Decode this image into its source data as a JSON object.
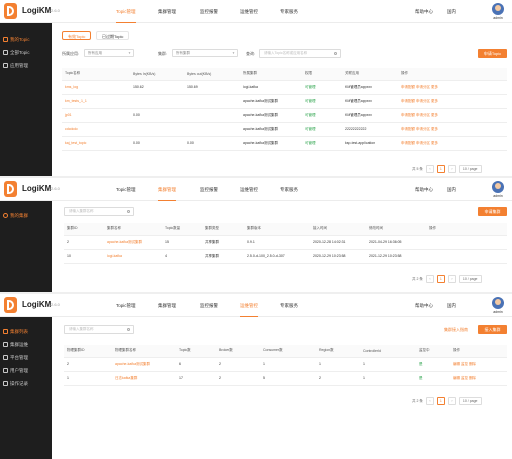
{
  "app": {
    "brand": "LogiKM",
    "version": "v2.6.0",
    "help": "帮助中心",
    "lang": "国内",
    "user": "admin"
  },
  "nav": [
    "Topic管理",
    "集群管理",
    "监控报警",
    "运维管控",
    "专家服务"
  ],
  "panel1": {
    "sidebar": [
      "我的Topic",
      "全部Topic",
      "应用管理"
    ],
    "tabs": [
      "有效Topic",
      "已过期Topic"
    ],
    "filter": {
      "app_label": "所属应用:",
      "app_value": "所有应用",
      "cluster_label": "集群:",
      "cluster_value": "所有集群",
      "search_label": "查询:",
      "search_placeholder": "请输入Topic名称或应用名称"
    },
    "apply_button": "申请Topic",
    "columns": [
      "Topic名称",
      "Bytes In(KB/s)",
      "Bytes out(KB/s)",
      "所属集群",
      "权限",
      "关联应用",
      "操作"
    ],
    "rows": [
      [
        "kms_log",
        "150.62",
        "150.69",
        "logi-kafka",
        "可管理",
        "KM管理员appxxx",
        "申请配额 申请分区 更多"
      ],
      [
        "km_tests_1_1",
        "",
        "",
        "apache-kafka测试集群",
        "可管理",
        "KM管理员appxxx",
        "申请配额 申请分区 更多"
      ],
      [
        "jp01",
        "0.00",
        "",
        "apache-kafka测试集群",
        "可管理",
        "KM管理员appxxx",
        "申请配额 申请分区 更多"
      ],
      [
        "cdcdcdc",
        "",
        "",
        "apache-kafka测试集群",
        "可管理",
        "22222222222",
        "申请配额 申请分区 更多"
      ],
      [
        "kaj_test_topic",
        "0.00",
        "0.00",
        "apache-kafka测试集群",
        "可管理",
        "ksp-test-application",
        "申请配额 申请分区 更多"
      ]
    ],
    "pagination": {
      "total": "共 5 条",
      "page": "1",
      "size": "10 / page"
    }
  },
  "panel2": {
    "sidebar": [
      "我的集群"
    ],
    "search_placeholder": "请输入集群名称",
    "apply_button": "申请集群",
    "columns": [
      "集群ID",
      "集群名称",
      "Topic数量",
      "集群类型",
      "集群版本",
      "接入时间",
      "修改时间",
      "操作"
    ],
    "rows": [
      [
        "2",
        "apache-kafka测试集群",
        "15",
        "共享集群",
        "0.9.1",
        "2020-12-28 14:02:31",
        "2021-04-29 16:36:05",
        ""
      ],
      [
        "10",
        "logi-kafka",
        "4",
        "共享集群",
        "2.5.0-d-100_2.5.0-d-307",
        "2020-12-29 10:23:58",
        "2021-12-29 10:23:58",
        ""
      ]
    ],
    "pagination": {
      "total": "共 2 条",
      "page": "1",
      "size": "10 / page"
    }
  },
  "panel3": {
    "sidebar": [
      "集群列表",
      "集群运维",
      "平台管理",
      "用户管理",
      "操作记录"
    ],
    "search_placeholder": "请输入集群名称",
    "extra_link": "集群接入指南",
    "add_button": "接入集群",
    "columns": [
      "物理集群ID",
      "物理集群名称",
      "Topic数",
      "Broker数",
      "Consumer数",
      "Region数",
      "Controllerld",
      "监控中",
      "操作"
    ],
    "rows": [
      [
        "2",
        "apache-kafka测试集群",
        "6",
        "2",
        "1",
        "1",
        "1",
        "是",
        "编辑 监控 删除"
      ],
      [
        "1",
        "日志kafka集群",
        "17",
        "2",
        "5",
        "2",
        "1",
        "是",
        "编辑 监控 删除"
      ]
    ],
    "pagination": {
      "total": "共 2 条",
      "page": "1",
      "size": "10 / page"
    }
  },
  "colors": {
    "accent": "#f38031",
    "sidebar": "#1e1e1e",
    "ok": "#2aa34a"
  }
}
